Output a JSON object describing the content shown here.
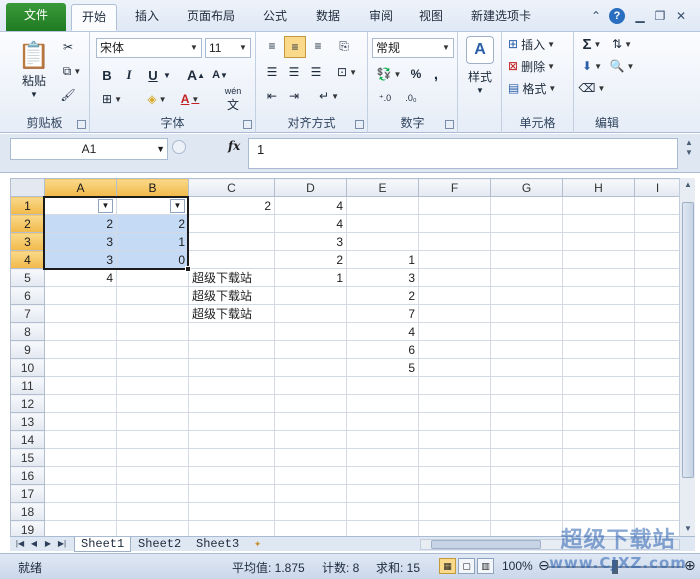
{
  "tabs": {
    "file": "文件",
    "items": [
      "开始",
      "插入",
      "页面布局",
      "公式",
      "数据",
      "审阅",
      "视图",
      "新建选项卡"
    ]
  },
  "ribbon": {
    "clipboard": {
      "label": "剪贴板",
      "paste": "粘贴"
    },
    "font": {
      "label": "字体",
      "name": "宋体",
      "size": "11",
      "bold": "B",
      "italic": "I",
      "underline": "U",
      "grow": "A",
      "shrink": "A",
      "phonetic": "wén"
    },
    "align": {
      "label": "对齐方式"
    },
    "number": {
      "label": "数字",
      "format": "常规",
      "percent": "%",
      "comma": ","
    },
    "style": {
      "label": "样式"
    },
    "cells": {
      "label": "单元格",
      "insert": "插入",
      "delete": "删除",
      "format": "格式"
    },
    "edit": {
      "label": "编辑"
    }
  },
  "formula_bar": {
    "name_box": "A1",
    "fx": "fx",
    "formula": "1"
  },
  "columns": [
    "A",
    "B",
    "C",
    "D",
    "E",
    "F",
    "G",
    "H",
    "I"
  ],
  "rows": [
    {
      "n": "1",
      "A": "",
      "B": "",
      "C": "2",
      "D": "4",
      "E": ""
    },
    {
      "n": "2",
      "A": "2",
      "B": "2",
      "C": "",
      "D": "4",
      "E": ""
    },
    {
      "n": "3",
      "A": "3",
      "B": "1",
      "C": "",
      "D": "3",
      "E": ""
    },
    {
      "n": "4",
      "A": "3",
      "B": "0",
      "C": "",
      "D": "2",
      "E": "1"
    },
    {
      "n": "5",
      "A": "4",
      "B": "",
      "C": "超级下载站",
      "D": "1",
      "E": "3"
    },
    {
      "n": "6",
      "A": "",
      "B": "",
      "C": "超级下载站",
      "D": "",
      "E": "2"
    },
    {
      "n": "7",
      "A": "",
      "B": "",
      "C": "超级下载站",
      "D": "",
      "E": "7"
    },
    {
      "n": "8",
      "A": "",
      "B": "",
      "C": "",
      "D": "",
      "E": "4"
    },
    {
      "n": "9",
      "A": "",
      "B": "",
      "C": "",
      "D": "",
      "E": "6"
    },
    {
      "n": "10",
      "A": "",
      "B": "",
      "C": "",
      "D": "",
      "E": "5"
    },
    {
      "n": "11",
      "A": "",
      "B": "",
      "C": "",
      "D": "",
      "E": ""
    },
    {
      "n": "12",
      "A": "",
      "B": "",
      "C": "",
      "D": "",
      "E": ""
    },
    {
      "n": "13",
      "A": "",
      "B": "",
      "C": "",
      "D": "",
      "E": ""
    },
    {
      "n": "14",
      "A": "",
      "B": "",
      "C": "",
      "D": "",
      "E": ""
    },
    {
      "n": "15",
      "A": "",
      "B": "",
      "C": "",
      "D": "",
      "E": ""
    },
    {
      "n": "16",
      "A": "",
      "B": "",
      "C": "",
      "D": "",
      "E": ""
    },
    {
      "n": "17",
      "A": "",
      "B": "",
      "C": "",
      "D": "",
      "E": ""
    },
    {
      "n": "18",
      "A": "",
      "B": "",
      "C": "",
      "D": "",
      "E": ""
    },
    {
      "n": "19",
      "A": "",
      "B": "",
      "C": "",
      "D": "",
      "E": ""
    }
  ],
  "sheets": [
    "Sheet1",
    "Sheet2",
    "Sheet3"
  ],
  "status": {
    "ready": "就绪",
    "average": "平均值: 1.875",
    "count": "计数: 8",
    "sum": "求和: 15",
    "zoom": "100%"
  },
  "watermark": {
    "title": "超级下载站",
    "url": "www.CJXZ.com"
  },
  "colors": {
    "file_tab": "#2a8a2c",
    "selection": "#c5daf4",
    "header_selected": "#f2b94a",
    "accent": "#e23b2f"
  }
}
